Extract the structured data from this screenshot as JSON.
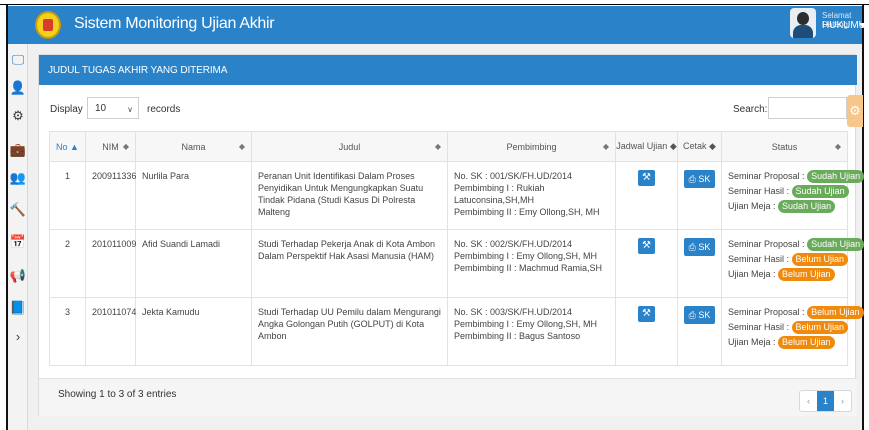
{
  "header": {
    "app_title": "Sistem Monitoring Ujian Akhir",
    "greeting": "Selamat Datang,",
    "username": "HUKUMUNIDAR"
  },
  "sidebar": {
    "items": [
      {
        "icon": "monitor-icon",
        "glyph": "🖵"
      },
      {
        "icon": "user-icon",
        "glyph": "👤"
      },
      {
        "icon": "gear-icon",
        "glyph": "⚙"
      },
      {
        "icon": "briefcase-icon",
        "glyph": "💼"
      },
      {
        "icon": "users-icon",
        "glyph": "👥"
      },
      {
        "icon": "gavel-icon",
        "glyph": "🔨"
      },
      {
        "icon": "calendar-icon",
        "glyph": "📅"
      },
      {
        "icon": "megaphone-icon",
        "glyph": "📢"
      },
      {
        "icon": "book-icon",
        "glyph": "📘"
      },
      {
        "icon": "circle-arrow-icon",
        "glyph": "›"
      }
    ]
  },
  "panel": {
    "title": "JUDUL TUGAS AKHIR YANG DITERIMA"
  },
  "controls": {
    "display_label": "Display",
    "page_size": "10",
    "records_label": "records",
    "search_label": "Search:",
    "search_value": ""
  },
  "table": {
    "columns": [
      "No",
      "NIM",
      "Nama",
      "Judul",
      "Pembimbing",
      "Jadwal Ujian",
      "Cetak",
      "Status"
    ],
    "cetak_label": "SK",
    "status_labels": {
      "proposal": "Seminar Proposal :",
      "hasil": "Seminar Hasil :",
      "meja": "Ujian Meja :"
    },
    "rows": [
      {
        "no": "1",
        "nim": "200911336",
        "nama": "Nurlila Para",
        "judul": "Peranan Unit Identifikasi Dalam Proses Penyidikan Untuk Mengungkapkan Suatu Tindak Pidana (Studi Kasus Di Polresta Malteng",
        "sk": "No. SK : 001/SK/FH.UD/2014",
        "pembimbing1": "Pembimbing I : Rukiah Latuconsina,SH,MH",
        "pembimbing2": "Pembimbing II : Emy Ollong,SH, MH",
        "status_proposal": "Sudah Ujian",
        "status_hasil": "Sudah Ujian",
        "status_meja": "Sudah Ujian"
      },
      {
        "no": "2",
        "nim": "201011009",
        "nama": "Afid Suandi Lamadi",
        "judul": "Studi Terhadap Pekerja Anak di Kota Ambon Dalam Perspektif Hak Asasi Manusia (HAM)",
        "sk": "No. SK : 002/SK/FH.UD/2014",
        "pembimbing1": "Pembimbing I : Emy Ollong,SH, MH",
        "pembimbing2": "Pembimbing II : Machmud Ramia,SH",
        "status_proposal": "Sudah Ujian",
        "status_hasil": "Belum Ujian",
        "status_meja": "Belum Ujian"
      },
      {
        "no": "3",
        "nim": "201011074",
        "nama": "Jekta Kamudu",
        "judul": "Studi Terhadap UU Pemilu dalam Mengurangi Angka Golongan Putih (GOLPUT) di Kota Ambon",
        "sk": "No. SK : 003/SK/FH.UD/2014",
        "pembimbing1": "Pembimbing I : Emy Ollong,SH, MH",
        "pembimbing2": "Pembimbing II : Bagus Santoso",
        "status_proposal": "Belum Ujian",
        "status_hasil": "Belum Ujian",
        "status_meja": "Belum Ujian"
      }
    ]
  },
  "footer": {
    "entries_info": "Showing 1 to 3 of 3 entries",
    "pager_prev": "‹",
    "pager_current": "1",
    "pager_next": "›"
  },
  "colors": {
    "primary": "#2a82c9",
    "badge_done": "#6aab5b",
    "badge_pending": "#f08a0c"
  }
}
